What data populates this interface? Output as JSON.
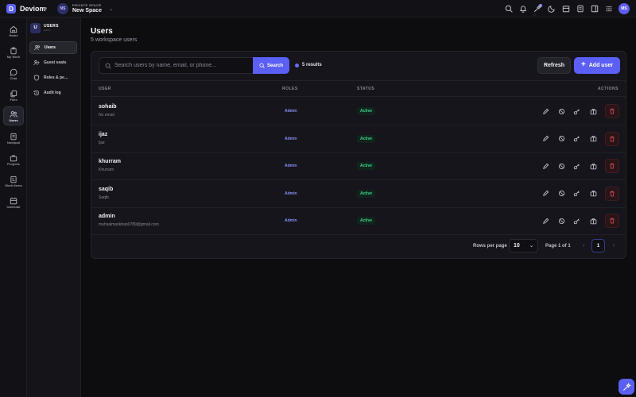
{
  "app": {
    "logo_letter": "D",
    "name": "Deviom"
  },
  "workspace": {
    "label": "PRIVATE SPACE",
    "name": "New Space",
    "initials": "NS"
  },
  "user": {
    "initials": "MS"
  },
  "rail": {
    "home": "Home",
    "my_work": "My Work",
    "chat": "Chat",
    "files": "Files",
    "users": "Users",
    "notepad": "Notepad",
    "projects": "Projects",
    "work_items": "Work Items",
    "calendar": "Calendar"
  },
  "subnav": {
    "badge": "U",
    "title": "USERS",
    "subtitle": "Admin",
    "items": [
      "Users",
      "Guest seats",
      "Roles & pe…",
      "Audit log"
    ]
  },
  "page": {
    "title": "Users",
    "subtitle": "5 workspace users"
  },
  "toolbar": {
    "search_placeholder": "Search users by name, email, or phone...",
    "search_label": "Search",
    "results_label": "5 results",
    "refresh_label": "Refresh",
    "add_label": "Add user"
  },
  "table": {
    "headers": {
      "user": "USER",
      "roles": "ROLES",
      "status": "STATUS",
      "actions": "ACTIONS"
    },
    "rows": [
      {
        "name": "sohaib",
        "sub": "No email",
        "role": "Admin",
        "status": "Active"
      },
      {
        "name": "ijaz",
        "sub": "Ijaz",
        "role": "Admin",
        "status": "Active"
      },
      {
        "name": "khurram",
        "sub": "Khurram",
        "role": "Admin",
        "status": "Active"
      },
      {
        "name": "saqib",
        "sub": "Saqib",
        "role": "Admin",
        "status": "Active"
      },
      {
        "name": "admin",
        "sub": "muhsalmankhan0789@gmail.com",
        "role": "Admin",
        "status": "Active"
      }
    ]
  },
  "pagination": {
    "rows_label": "Rows per page",
    "rows_value": "10",
    "page_info": "Page 1 of 1",
    "current": "1"
  },
  "colors": {
    "accent": "#5b5ff5",
    "active": "#3fd58a",
    "danger": "#e2555f",
    "background": "#0d0d10"
  }
}
